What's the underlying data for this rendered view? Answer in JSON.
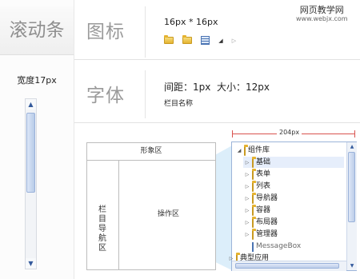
{
  "watermark": {
    "line1": "网页教学网",
    "line2": "www.webjx.com"
  },
  "left": {
    "title": "滚动条",
    "width_label": "宽度17px"
  },
  "scrollbar": {
    "up_icon": "▲",
    "down_icon": "▼"
  },
  "icons_row": {
    "title": "图标",
    "size_label": "16px * 16px",
    "icons": [
      "folder-icon",
      "folder-icon",
      "grid-icon",
      "triangle-down-icon",
      "triangle-right-icon"
    ]
  },
  "font_row": {
    "title": "字体",
    "spec": "间距：1px  大小：12px",
    "sample": "栏目名称"
  },
  "diagram": {
    "header": "形象区",
    "nav": "栏目导航区",
    "work": "操作区"
  },
  "measure": {
    "label": "204px"
  },
  "tree": {
    "root": "组件库",
    "children": [
      "基础",
      "表单",
      "列表",
      "导航器",
      "容器",
      "布局器",
      "管理器"
    ],
    "leaf": "MessageBox",
    "sibling": "典型应用",
    "selected_index": 0
  }
}
